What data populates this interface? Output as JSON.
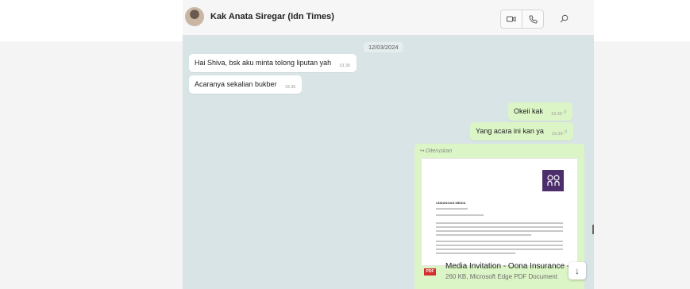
{
  "header": {
    "contact_name": "Kak Anata Siregar (Idn Times)",
    "video_icon": "video-camera-icon",
    "call_icon": "phone-icon",
    "search_icon": "search-icon"
  },
  "chat": {
    "date_divider": "12/03/2024",
    "messages": [
      {
        "text": "Hai Shiva, bsk aku minta tolong liputan yah",
        "time": "19.36"
      },
      {
        "text": "Acaranya sekalian bukber",
        "time": "19.36"
      },
      {
        "text": "Okeii kak",
        "time": "19.39",
        "ticks": "//"
      },
      {
        "text": "Yang acara ini kan ya",
        "time": "19.39",
        "ticks": "//"
      }
    ],
    "forwarded": {
      "label": "Diteruskan",
      "file_name": "Media Invitation - Oona Insurance -...",
      "file_meta": "260 KB, Microsoft Edge PDF Document",
      "file_type": "PDF",
      "doc_logo": "oo\nna",
      "doc_heading": "UNDANGAN MEDIA"
    }
  },
  "colors": {
    "chat_bg": "#d8e4e6",
    "outgoing_bubble": "#dcf5c6",
    "incoming_bubble": "#ffffff",
    "pdf_red": "#d32f2f",
    "logo_purple": "#4b2e6b"
  }
}
